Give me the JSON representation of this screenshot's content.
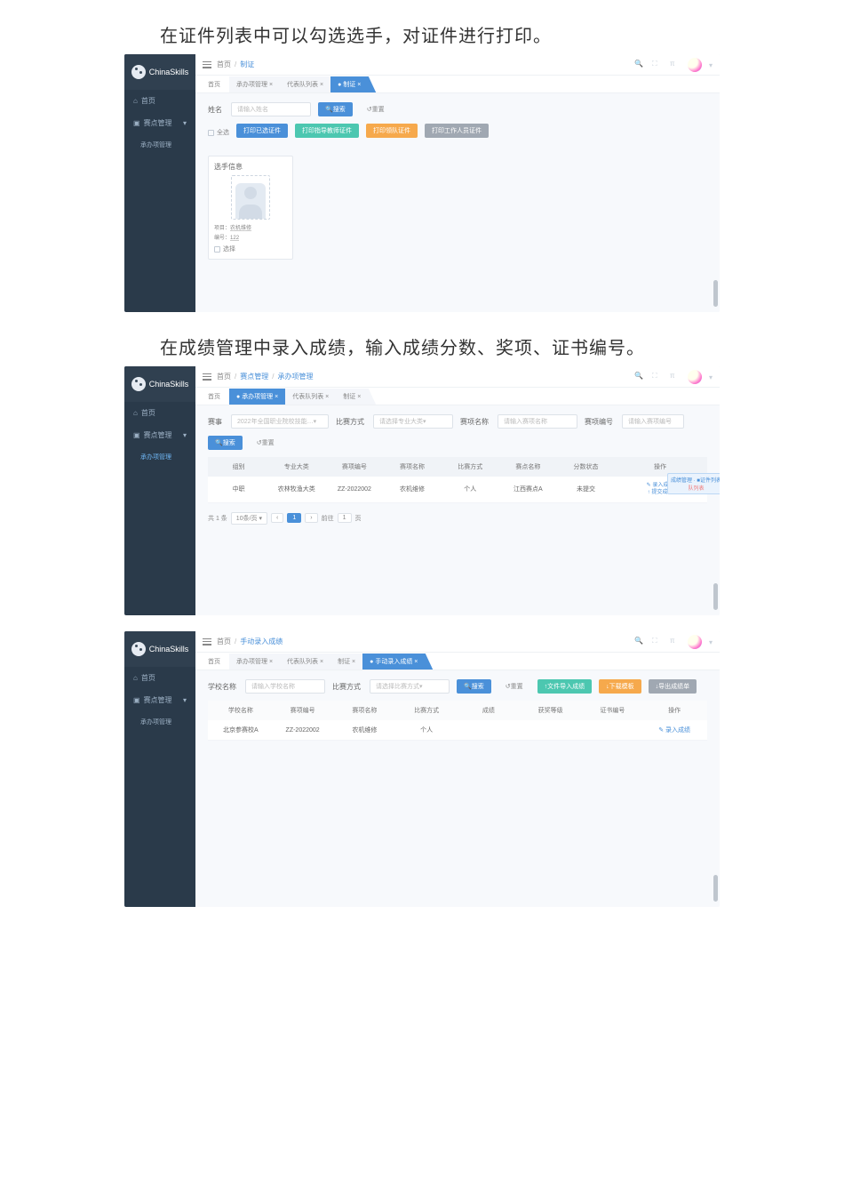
{
  "brand": "ChinaSkills",
  "caption1": "在证件列表中可以勾选选手，对证件进行打印。",
  "caption2": "在成绩管理中录入成绩，输入成绩分数、奖项、证书编号。",
  "sidebar": {
    "home": "首页",
    "sitemgr": "赛点管理",
    "bureau": "承办项管理"
  },
  "screen1": {
    "topbar": {
      "home": "首页",
      "current": "制证"
    },
    "bc": {
      "home": "首页",
      "t1": "承办项管理",
      "t2": "代表队列表",
      "active": "制证"
    },
    "name_label": "姓名",
    "name_placeholder": "请输入姓名",
    "search": "搜索",
    "reset": "重置",
    "select_all": "全选",
    "btn_selected": "打印已选证件",
    "btn_teacher": "打印指导教师证件",
    "btn_team": "打印领队证件",
    "btn_staff": "打印工作人员证件",
    "card": {
      "title": "选手信息",
      "proj_label": "项目：",
      "proj_val": "农机维修",
      "num_label": "编号：",
      "num_val": "122",
      "select": "选择"
    }
  },
  "screen2": {
    "topbar": {
      "home": "首页",
      "t1": "赛点管理",
      "current": "承办项管理"
    },
    "bc": {
      "home": "首页",
      "t1_active": "承办项管理",
      "t2": "代表队列表",
      "t3": "制证"
    },
    "filters": {
      "event_label": "赛事",
      "event_placeholder": "2022年全国职业院校技能…",
      "mode_label": "比赛方式",
      "mode_placeholder": "请选择专业大类",
      "item_label": "赛项名称",
      "item_placeholder": "请输入赛项名称",
      "code_label": "赛项编号",
      "code_placeholder": "请输入赛项编号"
    },
    "search": "搜索",
    "reset": "重置",
    "table": {
      "headers": [
        "组别",
        "专业大类",
        "赛项编号",
        "赛项名称",
        "比赛方式",
        "赛点名称",
        "分数状态",
        "操作"
      ],
      "row": {
        "group": "中职",
        "cat": "农林牧渔大类",
        "code": "ZZ-2022002",
        "name": "农机维修",
        "mode": "个人",
        "site": "江西赛点A",
        "status": "未提交"
      },
      "ops": {
        "enter": "录入成绩",
        "submit": "提交成绩"
      },
      "callouts": {
        "c1": "成绩管理",
        "c2": "证件列表",
        "c3": "队列表"
      }
    },
    "pager": {
      "total": "共 1 条",
      "size": "10条/页",
      "page": "1",
      "goto_pre": "前往",
      "goto_suf": "页"
    }
  },
  "screen3": {
    "topbar": {
      "home": "首页",
      "current": "手动录入成绩"
    },
    "bc": {
      "home": "首页",
      "t1": "承办项管理",
      "t2": "代表队列表",
      "t3": "制证",
      "active": "手动录入成绩"
    },
    "filters": {
      "school_label": "学校名称",
      "school_placeholder": "请输入学校名称",
      "mode_label": "比赛方式",
      "mode_placeholder": "请选择比赛方式"
    },
    "search": "搜索",
    "reset": "重置",
    "btn_import": "文件导入成绩",
    "btn_dl": "下载模板",
    "btn_export": "导出成绩单",
    "table": {
      "headers": [
        "学校名称",
        "赛项编号",
        "赛项名称",
        "比赛方式",
        "成绩",
        "获奖等级",
        "证书编号",
        "操作"
      ],
      "row": {
        "school": "北京参赛校A",
        "code": "ZZ-2022002",
        "name": "农机维修",
        "mode": "个人"
      },
      "ops": "录入成绩"
    }
  }
}
